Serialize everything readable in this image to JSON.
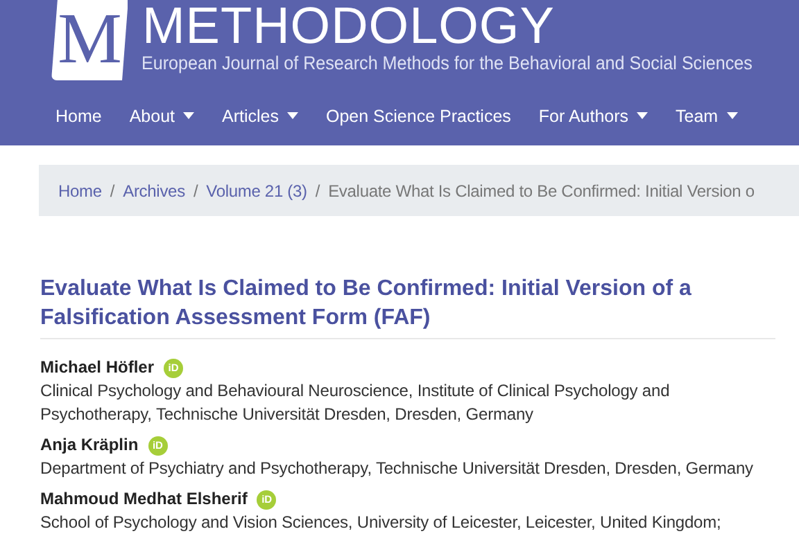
{
  "header": {
    "logo_letter": "M",
    "title": "METHODOLOGY",
    "subtitle": "European Journal of Research Methods for the Behavioral and Social Sciences"
  },
  "nav": [
    {
      "label": "Home",
      "dropdown": false
    },
    {
      "label": "About",
      "dropdown": true
    },
    {
      "label": "Articles",
      "dropdown": true
    },
    {
      "label": "Open Science Practices",
      "dropdown": false
    },
    {
      "label": "For Authors",
      "dropdown": true
    },
    {
      "label": "Team",
      "dropdown": true
    }
  ],
  "breadcrumb": [
    {
      "label": "Home",
      "current": false
    },
    {
      "label": "Archives",
      "current": false
    },
    {
      "label": "Volume 21 (3)",
      "current": false
    },
    {
      "label": "Evaluate What Is Claimed to Be Confirmed: Initial Version o",
      "current": true
    }
  ],
  "breadcrumb_separator": "/",
  "article": {
    "title": "Evaluate What Is Claimed to Be Confirmed: Initial Version of a Falsification Assessment Form (FAF)",
    "authors": [
      {
        "name": "Michael Höfler",
        "orcid": "iD",
        "affiliation": "Clinical Psychology and Behavioural Neuroscience, Institute of Clinical Psychology and Psychotherapy, Technische Universität Dresden, Dresden, Germany"
      },
      {
        "name": "Anja Kräplin",
        "orcid": "iD",
        "affiliation": "Department of Psychiatry and Psychotherapy, Technische Universität Dresden, Dresden, Germany"
      },
      {
        "name": "Mahmoud Medhat Elsherif",
        "orcid": "iD",
        "affiliation": "School of Psychology and Vision Sciences, University of Leicester, Leicester, United Kingdom;"
      }
    ]
  }
}
